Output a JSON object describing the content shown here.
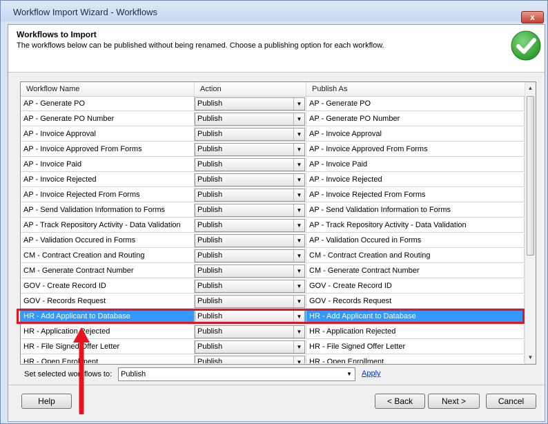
{
  "window": {
    "title": "Workflow Import Wizard - Workflows",
    "close_label": "x"
  },
  "header": {
    "title": "Workflows to Import",
    "description": "The workflows below can be published without being renamed. Choose a publishing option for each workflow.",
    "status_icon": "green-check-icon",
    "status_color": "#3aa83a"
  },
  "grid": {
    "columns": [
      "Workflow Name",
      "Action",
      "Publish As"
    ],
    "rows": [
      {
        "name": "AP - Generate PO",
        "action": "Publish",
        "publish_as": "AP - Generate PO"
      },
      {
        "name": "AP - Generate PO Number",
        "action": "Publish",
        "publish_as": "AP - Generate PO Number"
      },
      {
        "name": "AP - Invoice Approval",
        "action": "Publish",
        "publish_as": "AP - Invoice Approval"
      },
      {
        "name": "AP - Invoice Approved From Forms",
        "action": "Publish",
        "publish_as": "AP - Invoice Approved From Forms"
      },
      {
        "name": "AP - Invoice Paid",
        "action": "Publish",
        "publish_as": "AP - Invoice Paid"
      },
      {
        "name": "AP - Invoice Rejected",
        "action": "Publish",
        "publish_as": "AP - Invoice Rejected"
      },
      {
        "name": "AP - Invoice Rejected From Forms",
        "action": "Publish",
        "publish_as": "AP - Invoice Rejected From Forms"
      },
      {
        "name": "AP - Send Validation Information to Forms",
        "action": "Publish",
        "publish_as": "AP - Send Validation Information to Forms"
      },
      {
        "name": "AP - Track Repository Activity - Data Validation",
        "action": "Publish",
        "publish_as": "AP - Track Repository Activity - Data Validation"
      },
      {
        "name": "AP - Validation Occured in Forms",
        "action": "Publish",
        "publish_as": "AP - Validation Occured in Forms"
      },
      {
        "name": "CM - Contract Creation and Routing",
        "action": "Publish",
        "publish_as": "CM - Contract Creation and Routing"
      },
      {
        "name": "CM - Generate Contract Number",
        "action": "Publish",
        "publish_as": "CM - Generate Contract Number"
      },
      {
        "name": "GOV - Create Record ID",
        "action": "Publish",
        "publish_as": "GOV - Create Record ID"
      },
      {
        "name": "GOV - Records Request",
        "action": "Publish",
        "publish_as": "GOV - Records Request"
      },
      {
        "name": "HR - Add Applicant to Database",
        "action": "Publish",
        "publish_as": "HR - Add Applicant to Database"
      },
      {
        "name": "HR - Application Rejected",
        "action": "Publish",
        "publish_as": "HR - Application Rejected"
      },
      {
        "name": "HR - File Signed Offer Letter",
        "action": "Publish",
        "publish_as": "HR - File Signed Offer Letter"
      },
      {
        "name": "HR - Open Enrollment",
        "action": "Publish",
        "publish_as": "HR - Open Enrollment"
      }
    ],
    "selected_row": 14,
    "selection_color": "#3399ff",
    "highlight_color": "#e8131f"
  },
  "bulk": {
    "label": "Set selected workflows to:",
    "value": "Publish",
    "apply_label": "Apply"
  },
  "buttons": {
    "help": "Help",
    "back": "< Back",
    "next": "Next >",
    "cancel": "Cancel"
  }
}
